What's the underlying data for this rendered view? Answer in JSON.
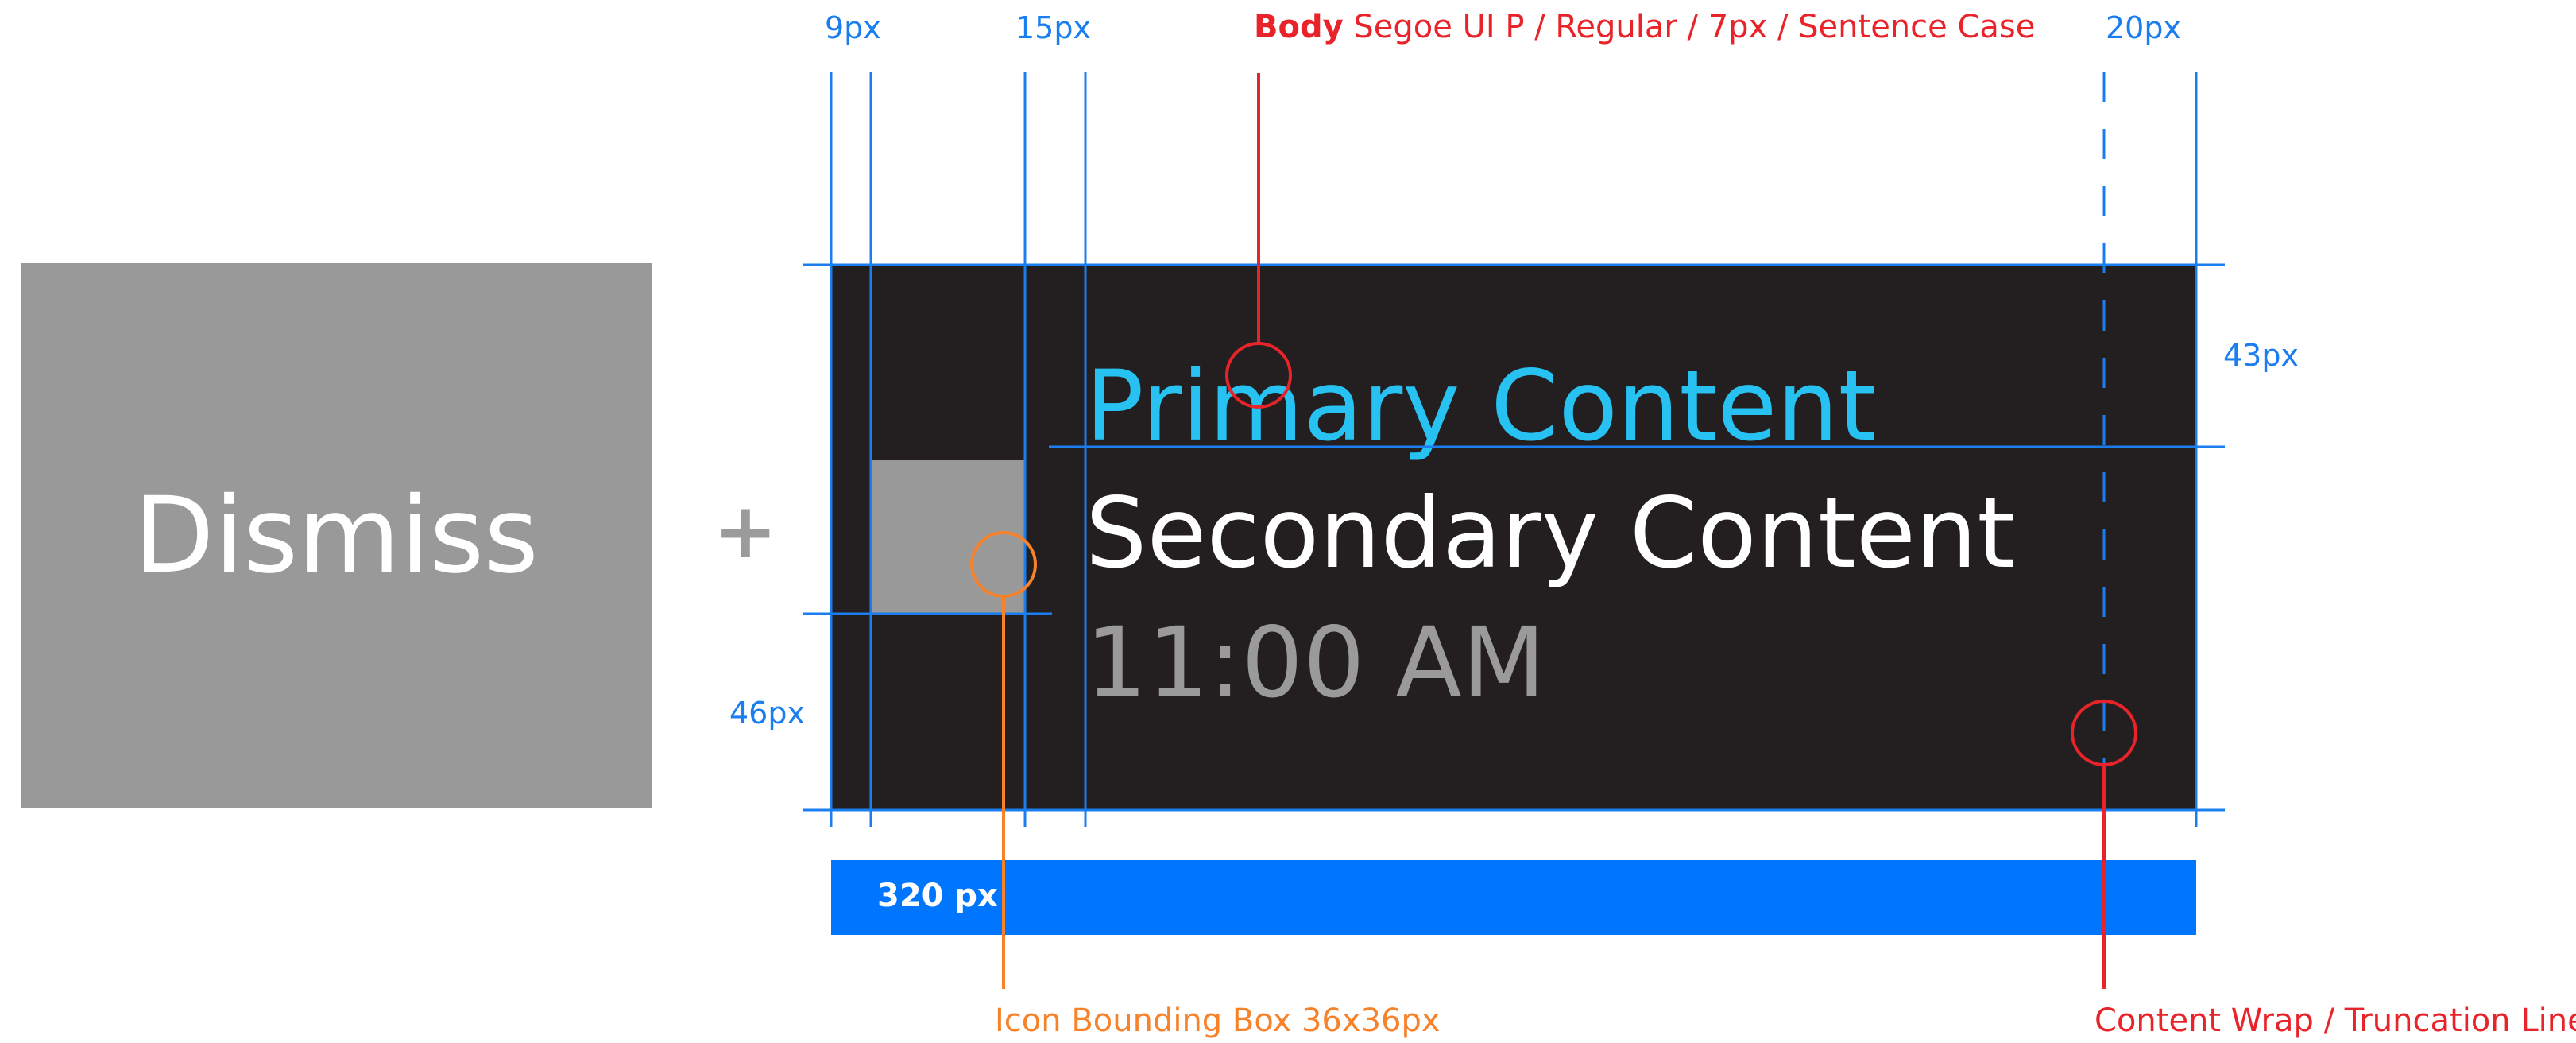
{
  "dismiss": {
    "label": "Dismiss"
  },
  "connector": {
    "symbol": "+"
  },
  "toast": {
    "primary": "Primary Content",
    "secondary": "Secondary Content",
    "time": "11:00 AM"
  },
  "width_bar": {
    "label": "320 px"
  },
  "measurements": {
    "left_margin": "9px",
    "icon_gap": "15px",
    "right_margin": "20px",
    "top_spacing": "43px",
    "bottom_spacing": "46px"
  },
  "annotations": {
    "body_bold": "Body",
    "body_spec": "Segoe UI P / Regular / 7px / Sentence Case",
    "icon_box": "Icon Bounding Box 36x36px",
    "wrap_line": "Content Wrap / Truncation Line"
  },
  "colors": {
    "guide_blue": "#1b7ef0",
    "callout_red": "#e8242a",
    "callout_orange": "#f7822a",
    "toast_bg": "#231f20",
    "primary_text": "#27c2f2",
    "bar_blue": "#0076ff"
  }
}
